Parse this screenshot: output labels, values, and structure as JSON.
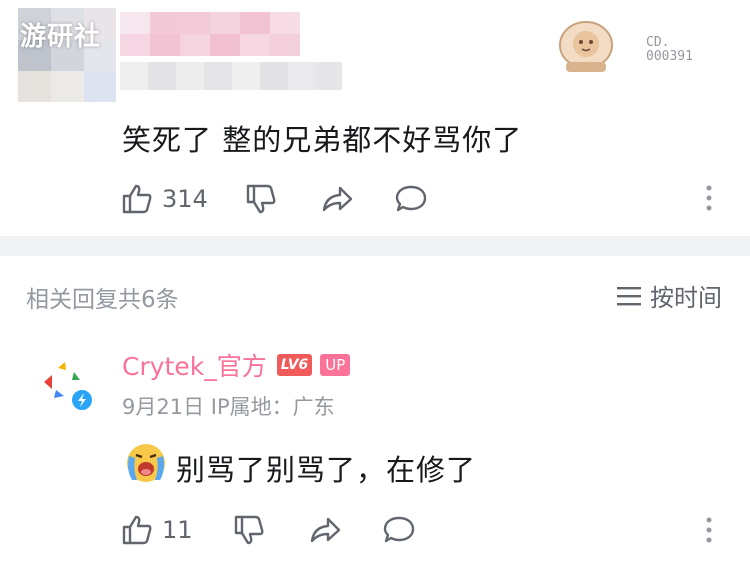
{
  "watermark": "游研社",
  "top_comment": {
    "badge_text": [
      "CD.",
      "000391"
    ],
    "text": "笑死了 整的兄弟都不好骂你了",
    "likes": "314"
  },
  "thread": {
    "related_label": "相关回复共6条",
    "sort_label": "按时间"
  },
  "reply": {
    "author": "Crytek_官方",
    "level": "LV6",
    "up_tag": "UP",
    "meta": "9月21日 IP属地：广东",
    "text": "别骂了别骂了，在修了",
    "likes": "11"
  },
  "colors": {
    "accent_pink": "#fb7299",
    "muted_text": "#9499a0",
    "icon_gray": "#61666d",
    "divider": "#f1f2f3"
  },
  "icons": [
    "like-icon",
    "dislike-icon",
    "share-icon",
    "reply-icon",
    "more-icon",
    "sort-icon",
    "verified-icon"
  ]
}
